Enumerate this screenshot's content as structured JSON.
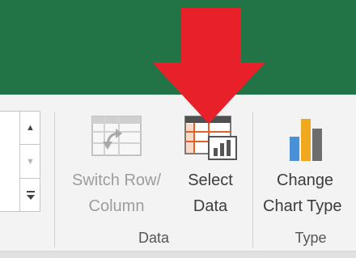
{
  "ribbon": {
    "buttons": {
      "switch_row_column": {
        "line1": "Switch Row/",
        "line2": "Column",
        "enabled": false
      },
      "select_data": {
        "line1": "Select",
        "line2": "Data",
        "enabled": true
      },
      "change_chart_type": {
        "line1": "Change",
        "line2": "Chart Type",
        "enabled": true
      }
    },
    "groups": {
      "data": "Data",
      "type": "Type"
    }
  },
  "icons": {
    "switch_row_column": "switch-row-column-icon",
    "select_data": "select-data-icon",
    "change_chart_type": "change-chart-type-icon",
    "gallery_up": "scroll-up-icon",
    "gallery_down": "scroll-down-icon",
    "gallery_more": "gallery-more-icon",
    "highlight_arrow": "red-arrow"
  },
  "colors": {
    "title_bar": "#227447",
    "ribbon_bg": "#f3f3f3",
    "arrow": "#e8202a"
  }
}
